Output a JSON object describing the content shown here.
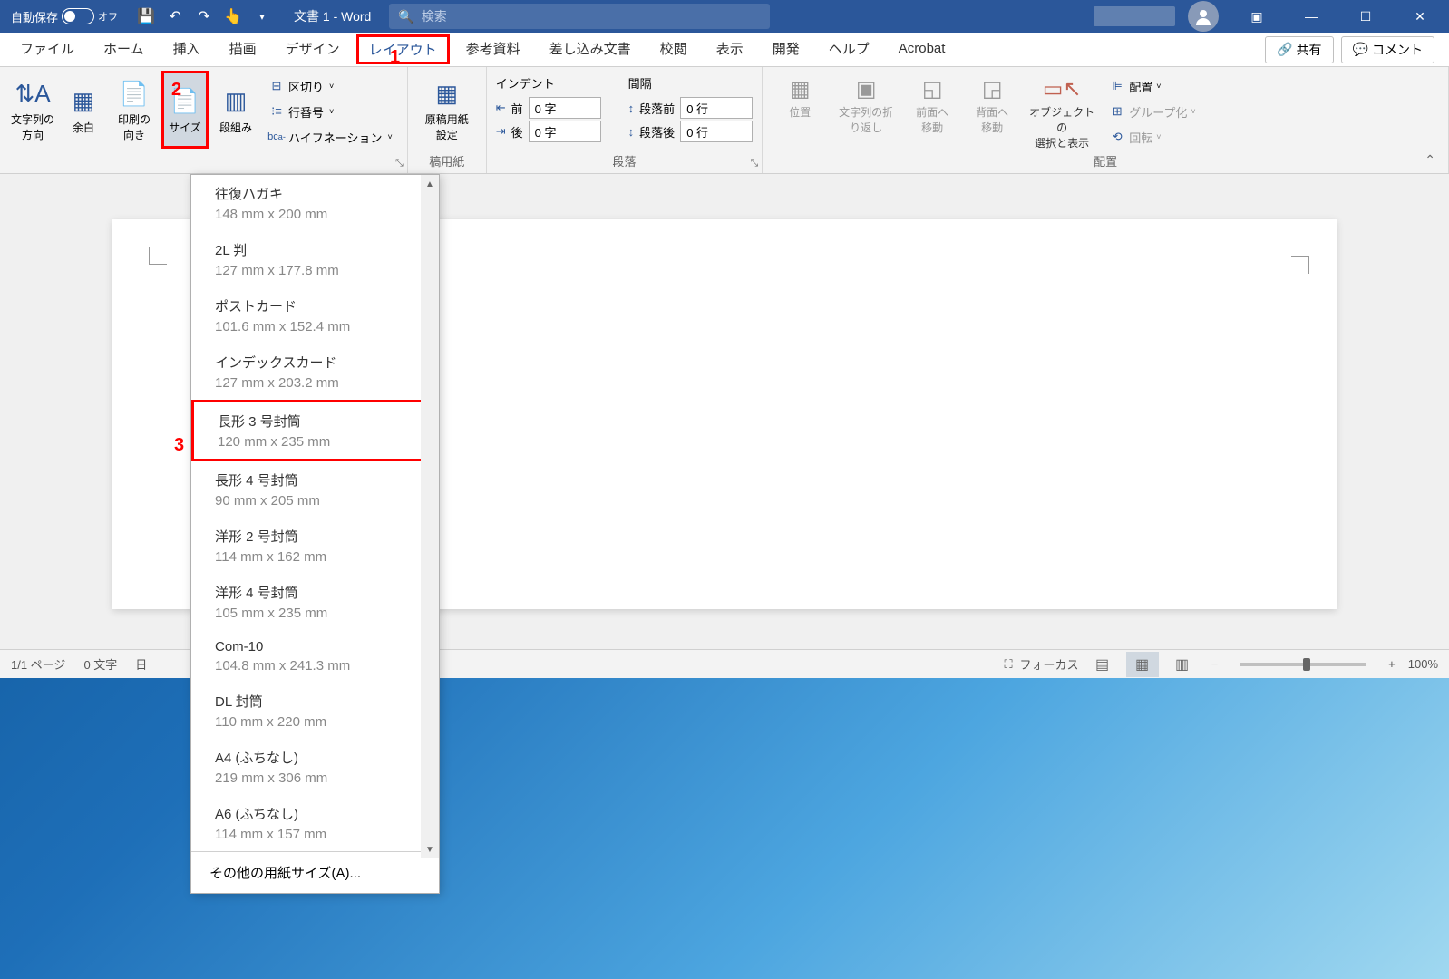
{
  "titlebar": {
    "autosave_label": "自動保存",
    "autosave_state": "オフ",
    "doc_title": "文書 1 - Word",
    "search_placeholder": "検索"
  },
  "tabs": {
    "file": "ファイル",
    "home": "ホーム",
    "insert": "挿入",
    "draw": "描画",
    "design": "デザイン",
    "layout": "レイアウト",
    "references": "参考資料",
    "mailings": "差し込み文書",
    "review": "校閲",
    "view": "表示",
    "developer": "開発",
    "help": "ヘルプ",
    "acrobat": "Acrobat",
    "share": "共有",
    "comment": "コメント"
  },
  "ribbon": {
    "text_direction": "文字列の\n方向",
    "margins": "余白",
    "orientation": "印刷の\n向き",
    "size": "サイズ",
    "columns": "段組み",
    "breaks": "区切り",
    "line_numbers": "行番号",
    "hyphenation": "ハイフネーション",
    "manuscript": "原稿用紙\n設定",
    "manuscript_group": "稿用紙",
    "indent_label": "インデント",
    "spacing_label": "間隔",
    "indent_before": "前",
    "indent_after": "後",
    "indent_val": "0 字",
    "spacing_before": "段落前",
    "spacing_after": "段落後",
    "spacing_val": "0 行",
    "paragraph_group": "段落",
    "position": "位置",
    "wrap": "文字列の折\nり返し",
    "bring_forward": "前面へ\n移動",
    "send_backward": "背面へ\n移動",
    "selection_pane": "オブジェクトの\n選択と表示",
    "align": "配置",
    "group": "グループ化",
    "rotate": "回転",
    "arrange_group": "配置"
  },
  "markers": {
    "m1": "1",
    "m2": "2",
    "m3": "3"
  },
  "dropdown": {
    "items": [
      {
        "title": "往復ハガキ",
        "sub": "148 mm x 200 mm"
      },
      {
        "title": "2L 判",
        "sub": "127 mm x 177.8 mm"
      },
      {
        "title": "ポストカード",
        "sub": "101.6 mm x 152.4 mm"
      },
      {
        "title": "インデックスカード",
        "sub": "127 mm x 203.2 mm"
      },
      {
        "title": "長形 3 号封筒",
        "sub": "120 mm x 235 mm",
        "marked": true
      },
      {
        "title": "長形 4 号封筒",
        "sub": "90 mm x 205 mm"
      },
      {
        "title": "洋形 2 号封筒",
        "sub": "114 mm x 162 mm"
      },
      {
        "title": "洋形 4 号封筒",
        "sub": "105 mm x 235 mm"
      },
      {
        "title": "Com-10",
        "sub": "104.8 mm x 241.3 mm"
      },
      {
        "title": "DL 封筒",
        "sub": "110 mm x 220 mm"
      },
      {
        "title": "A4 (ふちなし)",
        "sub": "219 mm x 306 mm"
      },
      {
        "title": "A6 (ふちなし)",
        "sub": "114 mm x 157 mm"
      }
    ],
    "footer": "その他の用紙サイズ(A)..."
  },
  "statusbar": {
    "page": "1/1 ページ",
    "words": "0 文字",
    "lang_prefix": "日",
    "focus": "フォーカス",
    "zoom": "100%"
  }
}
